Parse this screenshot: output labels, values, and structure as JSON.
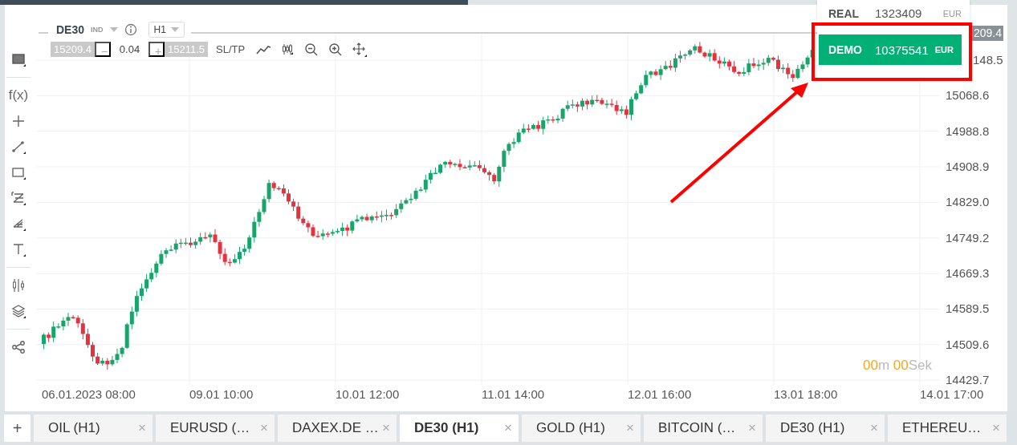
{
  "instrument": {
    "symbol": "DE30",
    "type": "IND",
    "timeframe": "H1"
  },
  "trade_bar": {
    "bid": "15209.4",
    "decrease": "−",
    "volume": "0.04",
    "increase": "+",
    "ask": "15211.5",
    "sltp": "SL/TP"
  },
  "left_toolbar": {
    "indicators": "f(x)"
  },
  "price_axis": {
    "current_price": "209.4",
    "labels": [
      "148.5",
      "15068.6",
      "14988.8",
      "14908.9",
      "14829.0",
      "14749.2",
      "14669.3",
      "14589.5",
      "14509.6",
      "14429.7"
    ]
  },
  "time_axis": {
    "labels": [
      "06.01.2023 08:00",
      "09.01 10:00",
      "10.01 12:00",
      "11.01 14:00",
      "12.01 16:00",
      "13.01 18:00",
      "14.01 17:00"
    ]
  },
  "countdown": {
    "minutes": "00",
    "minutes_unit": "m",
    "seconds": "00",
    "seconds_unit": "Sek"
  },
  "account_menu": {
    "items": [
      {
        "label": "REAL",
        "balance": "1323409",
        "currency": "EUR",
        "selected": false
      },
      {
        "label": "DEMO",
        "balance": "10375541",
        "currency": "EUR",
        "selected": true
      }
    ]
  },
  "tabs": {
    "add": "+",
    "items": [
      {
        "label": "OIL (H1)",
        "close": "×",
        "selected": false
      },
      {
        "label": "EURUSD (…",
        "close": "×",
        "selected": false
      },
      {
        "label": "DAXEX.DE …",
        "close": "×",
        "selected": false
      },
      {
        "label": "DE30 (H1)",
        "close": "×",
        "selected": true
      },
      {
        "label": "GOLD (H1)",
        "close": "×",
        "selected": false
      },
      {
        "label": "BITCOIN (…",
        "close": "×",
        "selected": false
      },
      {
        "label": "DE30 (H1)",
        "close": "×",
        "selected": false
      },
      {
        "label": "ETHEREU…",
        "close": "×",
        "selected": false
      }
    ]
  }
}
